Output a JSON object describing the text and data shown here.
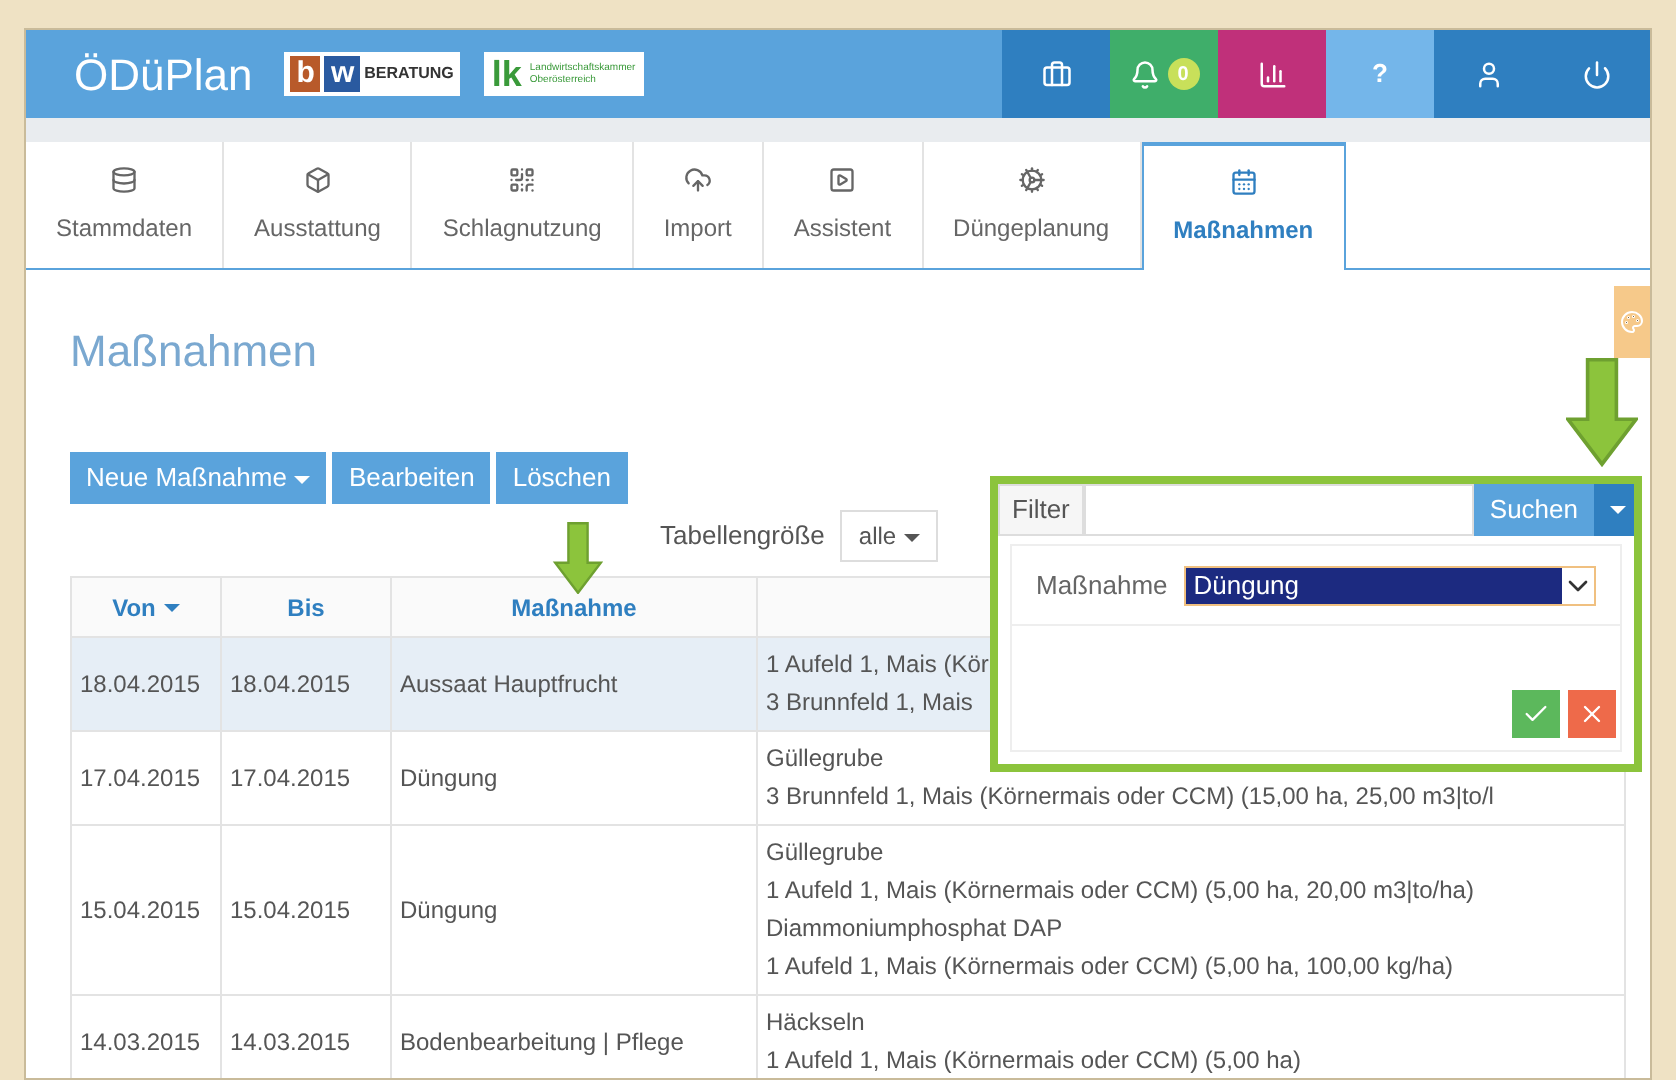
{
  "app": {
    "title": "ÖDüPlan",
    "logos": [
      {
        "kind": "bw",
        "letters": [
          "b",
          "w"
        ],
        "text": "BERATUNG"
      },
      {
        "kind": "lk",
        "letters": "lk",
        "lines": [
          "Landwirtschaftskammer",
          "Oberösterreich"
        ]
      }
    ],
    "header_buttons": [
      {
        "kind": "briefcase"
      },
      {
        "kind": "bell",
        "badge": "0"
      },
      {
        "kind": "chart"
      },
      {
        "kind": "help",
        "label": "?"
      },
      {
        "kind": "user"
      },
      {
        "kind": "power"
      }
    ]
  },
  "tabs": [
    {
      "label": "Stammdaten",
      "selected": false
    },
    {
      "label": "Ausstattung",
      "selected": false
    },
    {
      "label": "Schlagnutzung",
      "selected": false
    },
    {
      "label": "Import",
      "selected": false
    },
    {
      "label": "Assistent",
      "selected": false
    },
    {
      "label": "Düngeplanung",
      "selected": false
    },
    {
      "label": "Maßnahmen",
      "selected": true
    }
  ],
  "page": {
    "heading": "Maßnahmen",
    "actions": [
      {
        "label": "Neue Maßnahme",
        "dropdown": true
      },
      {
        "label": "Bearbeiten",
        "dropdown": false
      },
      {
        "label": "Löschen",
        "dropdown": false
      }
    ],
    "table_size": {
      "label": "Tabellengröße",
      "value": "alle"
    },
    "filter": {
      "label": "Filter",
      "search_button": "Suchen",
      "expanded": true,
      "fields": [
        {
          "label": "Maßnahme",
          "value": "Düngung"
        }
      ]
    }
  },
  "table": {
    "columns": [
      {
        "label": "Von",
        "sorted": true
      },
      {
        "label": "Bis",
        "sorted": false
      },
      {
        "label": "Maßnahme",
        "sorted": false
      }
    ],
    "rows": [
      {
        "selected": true,
        "von": "18.04.2015",
        "bis": "18.04.2015",
        "massnahme": "Aussaat Hauptfrucht",
        "details": [
          "1 Aufeld 1, Mais (Kör",
          "3 Brunnfeld 1, Mais"
        ]
      },
      {
        "selected": false,
        "von": "17.04.2015",
        "bis": "17.04.2015",
        "massnahme": "Düngung",
        "details": [
          "Güllegrube",
          "3 Brunnfeld 1, Mais (Körnermais oder CCM) (15,00 ha, 25,00 m3|to/l"
        ]
      },
      {
        "selected": false,
        "von": "15.04.2015",
        "bis": "15.04.2015",
        "massnahme": "Düngung",
        "details": [
          "Güllegrube",
          "1 Aufeld 1, Mais (Körnermais oder CCM) (5,00 ha, 20,00 m3|to/ha)",
          "Diammoniumphosphat DAP",
          "1 Aufeld 1, Mais (Körnermais oder CCM) (5,00 ha, 100,00 kg/ha)"
        ]
      },
      {
        "selected": false,
        "von": "14.03.2015",
        "bis": "14.03.2015",
        "massnahme": "Bodenbearbeitung | Pflege",
        "details": [
          "Häckseln",
          "1 Aufeld 1, Mais (Körnermais oder CCM) (5,00 ha)"
        ]
      }
    ]
  }
}
